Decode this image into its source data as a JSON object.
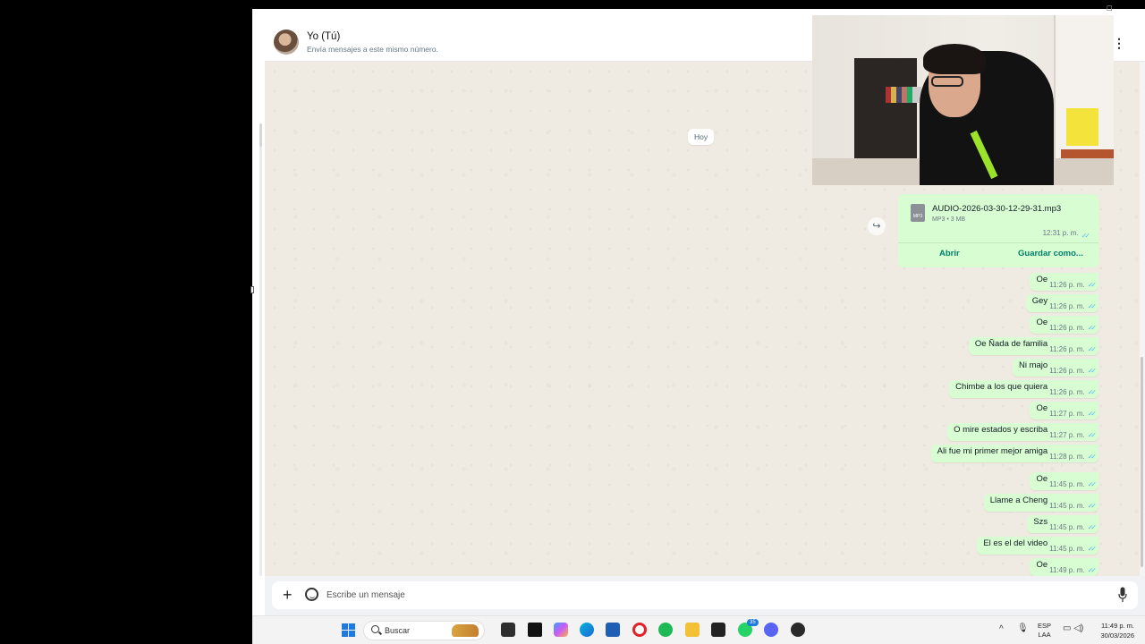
{
  "header": {
    "contact_name": "Yo (Tú)",
    "contact_subtitle": "Envía mensajes a este mismo número."
  },
  "chat": {
    "date_label": "Hoy",
    "file_message": {
      "filename": "AUDIO-2026-03-30-12-29-31.mp3",
      "file_type_badge": "MP3",
      "meta": "MP3 • 3 MB",
      "time": "12:31 p. m.",
      "open_label": "Abrir",
      "save_label": "Guardar como..."
    },
    "messages": [
      {
        "text": "Oe",
        "time": "11:26 p. m."
      },
      {
        "text": "Gey",
        "time": "11:26 p. m."
      },
      {
        "text": "Oe",
        "time": "11:26 p. m."
      },
      {
        "text": "Oe Ñada de familia",
        "time": "11:26 p. m."
      },
      {
        "text": "Ni majo",
        "time": "11:26 p. m."
      },
      {
        "text": "Chimbe a los que quiera",
        "time": "11:26 p. m."
      },
      {
        "text": "Oe",
        "time": "11:27 p. m."
      },
      {
        "text": "O mire estados y escriba",
        "time": "11:27 p. m."
      },
      {
        "text": "Ali fue mi primer mejor amiga",
        "time": "11:28 p. m."
      },
      {
        "text": "Oe",
        "time": "11:45 p. m."
      },
      {
        "text": "Llame a Cheng",
        "time": "11:45 p. m."
      },
      {
        "text": "Szs",
        "time": "11:45 p. m."
      },
      {
        "text": "El es el del video",
        "time": "11:45 p. m."
      },
      {
        "text": "Oe",
        "time": "11:49 p. m."
      }
    ]
  },
  "composer": {
    "placeholder": "Escribe un mensaje"
  },
  "taskbar": {
    "search_label": "Buscar",
    "whatsapp_badge": "35",
    "language_line1": "ESP",
    "language_line2": "LAA",
    "clock_time": "11:49 p. m.",
    "clock_date": "30/03/2026",
    "icons": [
      "start-icon",
      "files-icon",
      "capcut-icon",
      "copilot-icon",
      "edge-icon",
      "store-icon",
      "opera-icon",
      "spotify-icon",
      "explorer-icon",
      "epic-games-icon",
      "whatsapp-icon",
      "discord-icon",
      "davinci-icon"
    ]
  },
  "colors": {
    "outgoing_bubble": "#d9fdd3",
    "chat_background": "#efeae2",
    "accent_green": "#008069",
    "read_ticks": "#53bdeb"
  }
}
